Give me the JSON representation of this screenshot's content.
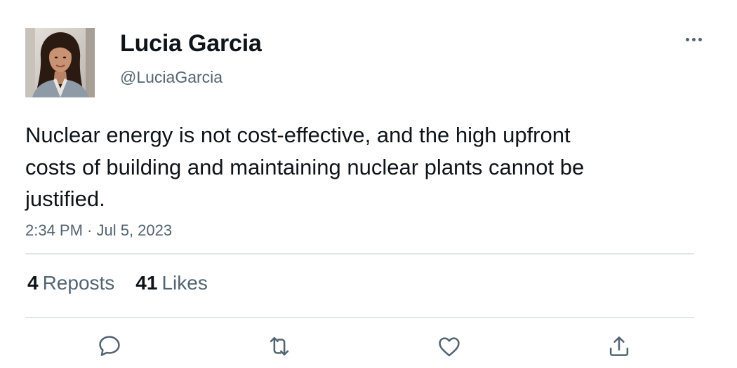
{
  "user": {
    "display_name": "Lucia Garcia",
    "handle": "@LuciaGarcia",
    "avatar_icon": "profile-photo"
  },
  "tweet": {
    "text": "Nuclear energy is not cost-effective, and the high upfront costs of building and maintaining nuclear plants cannot be justified.",
    "timestamp": "2:34 PM · Jul 5, 2023"
  },
  "stats": {
    "reposts_count": "4",
    "reposts_label": "Reposts",
    "likes_count": "41",
    "likes_label": "Likes"
  },
  "actions": {
    "reply_icon": "speech-bubble-icon",
    "repost_icon": "repost-arrows-icon",
    "like_icon": "heart-icon",
    "share_icon": "upload-arrow-icon"
  },
  "colors": {
    "primary_text": "#0f1419",
    "secondary_text": "#536471",
    "divider": "#e1e5e8"
  }
}
